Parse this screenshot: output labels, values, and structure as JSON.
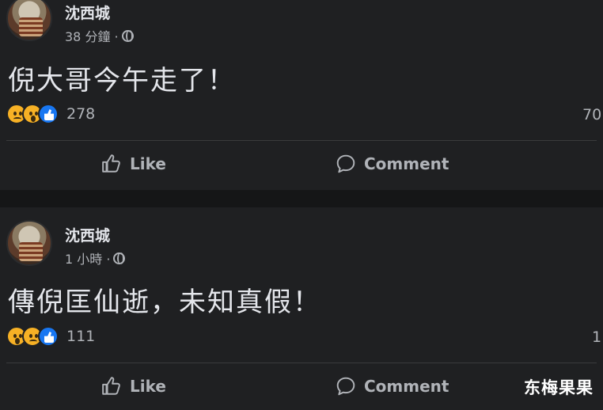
{
  "posts": [
    {
      "author": "沈西城",
      "time": "38 分鐘 ·",
      "text": "倪大哥今午走了！",
      "reaction_count": "278",
      "right_count": "70",
      "actions": {
        "like": "Like",
        "comment": "Comment"
      }
    },
    {
      "author": "沈西城",
      "time": "1 小時 ·",
      "text": "傳倪匡仙逝，未知真假！",
      "reaction_count": "111",
      "right_count": "1",
      "actions": {
        "like": "Like",
        "comment": "Comment"
      }
    }
  ],
  "watermark": "东梅果果",
  "colors": {
    "background": "#1f2022",
    "text": "#e4e6eb",
    "muted": "#b0b3b8",
    "like_blue": "#1877f2",
    "emoji_yellow": "#f7b125"
  },
  "icons": [
    "globe-icon",
    "sad-reaction-icon",
    "wow-reaction-icon",
    "like-reaction-icon",
    "thumbs-up-icon",
    "comment-icon"
  ]
}
